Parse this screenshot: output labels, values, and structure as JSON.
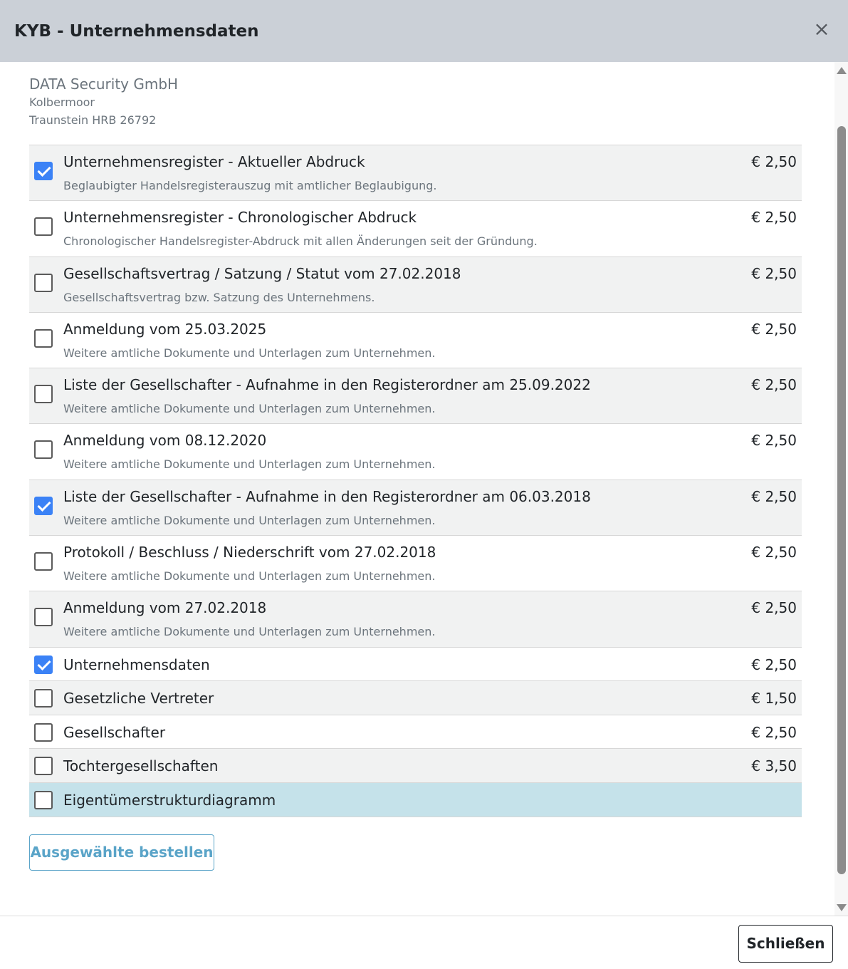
{
  "header": {
    "title": "KYB - Unternehmensdaten",
    "close_icon": "×"
  },
  "company": {
    "name": "DATA Security GmbH",
    "city": "Kolbermoor",
    "register": "Traunstein HRB 26792"
  },
  "items": [
    {
      "title": "Unternehmensregister - Aktueller Abdruck",
      "description": "Beglaubigter Handelsregisterauszug mit amtlicher Beglaubigung.",
      "price": "€ 2,50",
      "checked": true
    },
    {
      "title": "Unternehmensregister - Chronologischer Abdruck",
      "description": "Chronologischer Handelsregister-Abdruck mit allen Änderungen seit der Gründung.",
      "price": "€ 2,50",
      "checked": false
    },
    {
      "title": "Gesellschaftsvertrag / Satzung / Statut vom 27.02.2018",
      "description": "Gesellschaftsvertrag bzw. Satzung des Unternehmens.",
      "price": "€ 2,50",
      "checked": false
    },
    {
      "title": "Anmeldung vom 25.03.2025",
      "description": "Weitere amtliche Dokumente und Unterlagen zum Unternehmen.",
      "price": "€ 2,50",
      "checked": false
    },
    {
      "title": "Liste der Gesellschafter - Aufnahme in den Registerordner am 25.09.2022",
      "description": "Weitere amtliche Dokumente und Unterlagen zum Unternehmen.",
      "price": "€ 2,50",
      "checked": false
    },
    {
      "title": "Anmeldung vom 08.12.2020",
      "description": "Weitere amtliche Dokumente und Unterlagen zum Unternehmen.",
      "price": "€ 2,50",
      "checked": false
    },
    {
      "title": "Liste der Gesellschafter - Aufnahme in den Registerordner am 06.03.2018",
      "description": "Weitere amtliche Dokumente und Unterlagen zum Unternehmen.",
      "price": "€ 2,50",
      "checked": true
    },
    {
      "title": "Protokoll / Beschluss / Niederschrift vom 27.02.2018",
      "description": "Weitere amtliche Dokumente und Unterlagen zum Unternehmen.",
      "price": "€ 2,50",
      "checked": false
    },
    {
      "title": "Anmeldung vom 27.02.2018",
      "description": "Weitere amtliche Dokumente und Unterlagen zum Unternehmen.",
      "price": "€ 2,50",
      "checked": false
    },
    {
      "title": "Unternehmensdaten",
      "description": "",
      "price": "€ 2,50",
      "checked": true
    },
    {
      "title": "Gesetzliche Vertreter",
      "description": "",
      "price": "€ 1,50",
      "checked": false
    },
    {
      "title": "Gesellschafter",
      "description": "",
      "price": "€ 2,50",
      "checked": false
    },
    {
      "title": "Tochtergesellschaften",
      "description": "",
      "price": "€ 3,50",
      "checked": false
    },
    {
      "title": "Eigentümerstrukturdiagramm",
      "description": "",
      "price": "",
      "checked": false
    }
  ],
  "actions": {
    "order_label": "Ausgewählte bestellen",
    "close_label": "Schließen"
  },
  "colors": {
    "header_bg": "#cbd0d7",
    "checkbox_checked": "#3b82f6",
    "row_shaded": "#f1f2f2",
    "row_highlight": "#c5e2ea",
    "order_button": "#5aa4c8"
  }
}
